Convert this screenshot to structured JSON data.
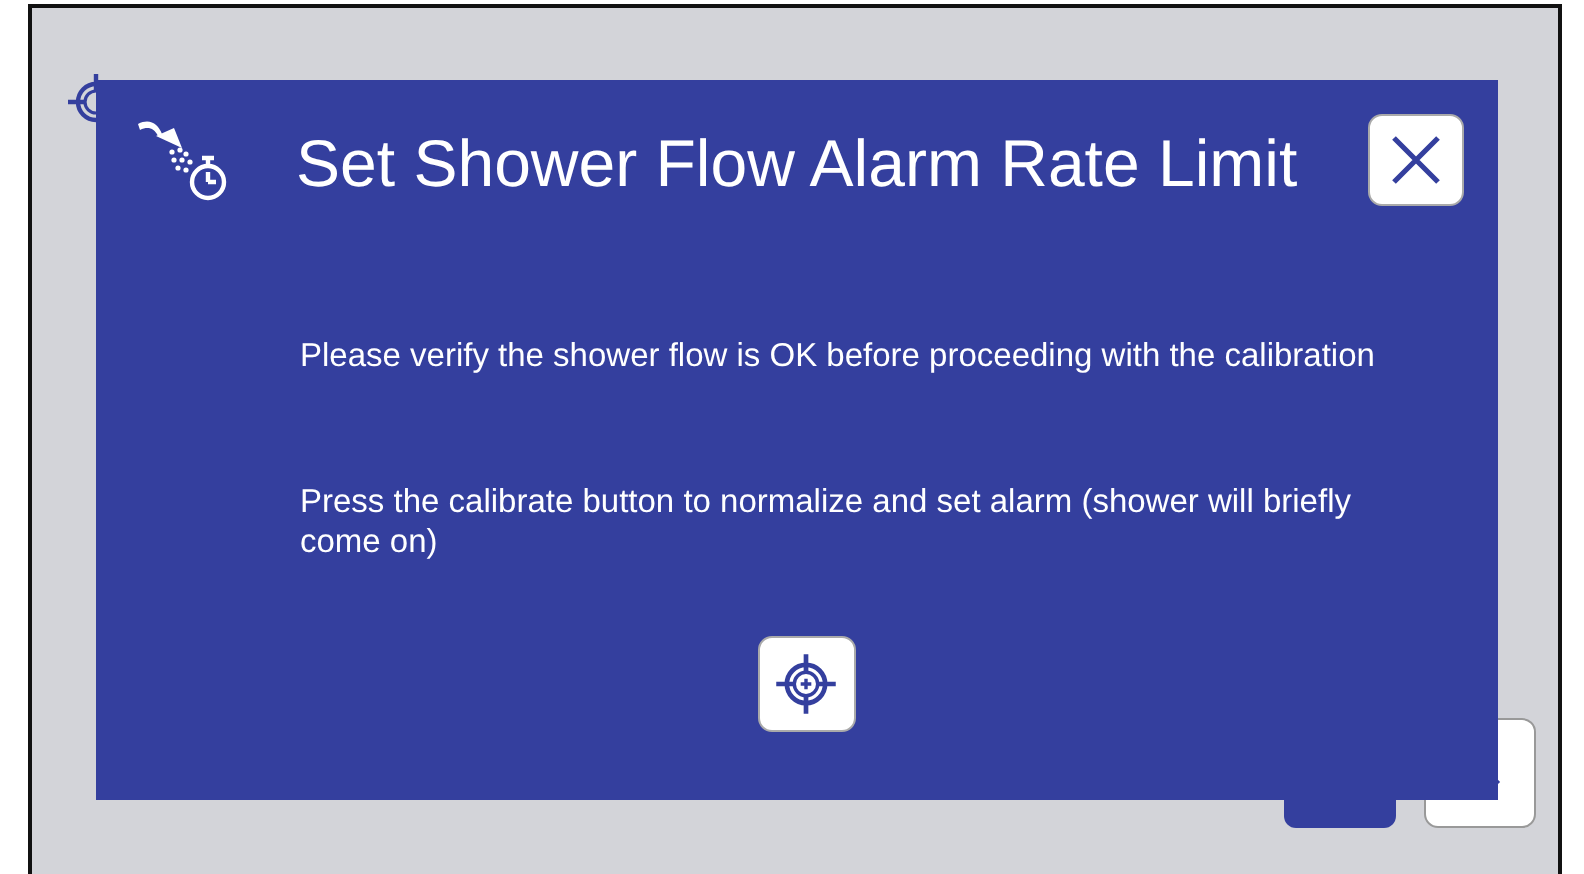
{
  "dialog": {
    "title": "Set Shower Flow Alarm Rate Limit",
    "messages": [
      "Please verify the shower flow is OK before proceeding with the calibration",
      "Press the calibrate button to normalize and set alarm (shower will briefly come on)"
    ]
  }
}
